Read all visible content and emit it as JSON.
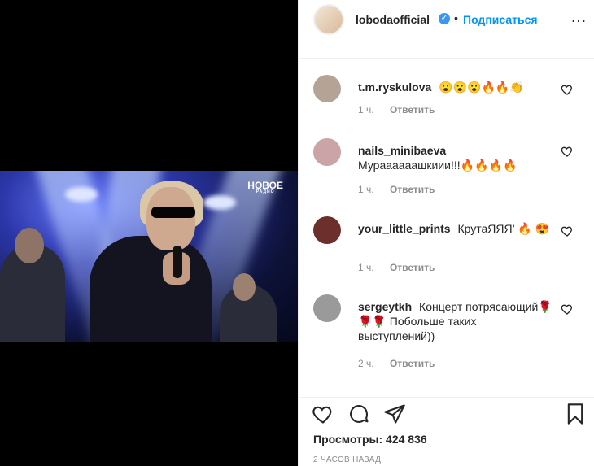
{
  "video": {
    "logo_text": "НОВОЕ",
    "logo_sub": "РАДИО"
  },
  "header": {
    "username": "lobodaofficial",
    "verified_icon": "check-icon",
    "separator": "•",
    "follow_label": "Подписаться",
    "more_icon": "…"
  },
  "comments": [
    {
      "user": "t.m.ryskulova",
      "text": "😮😮😮🔥🔥👏",
      "time": "1 ч.",
      "reply": "Ответить",
      "avatar_color": "#b5a495"
    },
    {
      "user": "nails_minibaeva",
      "text": "Мураааааашкиии!!!🔥🔥🔥🔥",
      "time": "1 ч.",
      "reply": "Ответить",
      "avatar_color": "#caa4a6"
    },
    {
      "user": "your_little_prints",
      "text": "КрутаЯЯЯ’ 🔥 😍",
      "time": "1 ч.",
      "reply": "Ответить",
      "avatar_color": "#6d2f2c"
    },
    {
      "user": "sergeytkh",
      "text": "Концерт потрясающий🌹🌹🌹 Побольше таких выступлений))",
      "time": "2 ч.",
      "reply": "Ответить",
      "avatar_color": "#9a9a9a"
    }
  ],
  "footer": {
    "views": "Просмотры: 424 836",
    "timestamp": "2 ЧАСОВ НАЗАД"
  },
  "colors": {
    "accent": "#0095f6",
    "muted": "#8e8e8e"
  }
}
